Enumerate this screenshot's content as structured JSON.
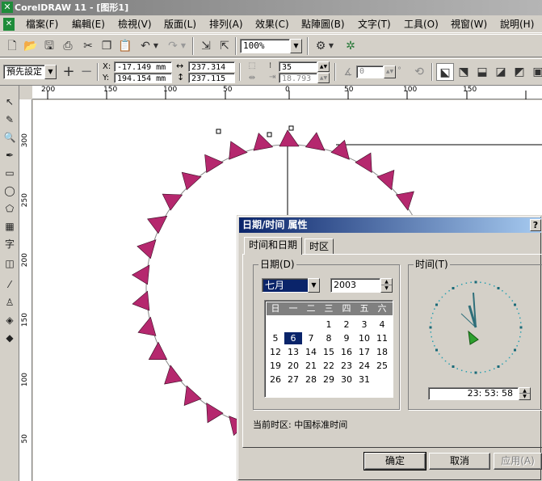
{
  "window": {
    "title": "CorelDRAW 11 - [图形1]",
    "app_icon": "coreldraw-icon"
  },
  "menu": [
    "檔案(F)",
    "編輯(E)",
    "檢視(V)",
    "版面(L)",
    "排列(A)",
    "效果(C)",
    "點陣圖(B)",
    "文字(T)",
    "工具(O)",
    "視窗(W)",
    "說明(H)"
  ],
  "standard_toolbar": {
    "zoom_value": "100%"
  },
  "property_bar": {
    "preset_label": "預先設定",
    "x_label": "X:",
    "x_value": "-17.149 mm",
    "y_label": "Y:",
    "y_value": "194.154 mm",
    "width_value": "237.314",
    "height_value": "237.115",
    "steps_value": "35",
    "offset_value": "18.793",
    "angle_value": "0",
    "degree_symbol": "°"
  },
  "ruler_h": [
    "200",
    "150",
    "100",
    "50",
    "0",
    "50",
    "100",
    "150"
  ],
  "ruler_v": [
    "300",
    "250",
    "200",
    "150",
    "100",
    "50"
  ],
  "dialog": {
    "title": "日期/时间 属性",
    "help_button": "?",
    "tabs": [
      "时间和日期",
      "时区"
    ],
    "date_group_label": "日期(D)",
    "month_value": "七月",
    "year_value": "2003",
    "weekday_headers": [
      "日",
      "一",
      "二",
      "三",
      "四",
      "五",
      "六"
    ],
    "calendar_rows": [
      [
        "",
        "",
        "",
        "1",
        "2",
        "3",
        "4"
      ],
      [
        "5",
        "6",
        "7",
        "8",
        "9",
        "10",
        "11"
      ],
      [
        "12",
        "13",
        "14",
        "15",
        "16",
        "17",
        "18"
      ],
      [
        "19",
        "20",
        "21",
        "22",
        "23",
        "24",
        "25"
      ],
      [
        "26",
        "27",
        "28",
        "29",
        "30",
        "31",
        ""
      ]
    ],
    "calendar_grid": [
      [
        "",
        "",
        "1",
        "2",
        "3",
        "4",
        ""
      ],
      [
        "6",
        "7",
        "8",
        "9",
        "10",
        "11",
        "12"
      ],
      [
        "13",
        "14",
        "15",
        "16",
        "17",
        "18",
        "19"
      ],
      [
        "20",
        "21",
        "22",
        "23",
        "24",
        "25",
        "26"
      ],
      [
        "27",
        "28",
        "29",
        "30",
        "31",
        "",
        ""
      ]
    ],
    "selected_day": "6",
    "time_group_label": "时间(T)",
    "time_value": "23: 53: 58",
    "timezone_text": "当前时区: 中国标准时间",
    "ok_button": "确定",
    "cancel_button": "取消",
    "apply_button": "应用(A)"
  },
  "colors": {
    "triangle": "#b5286e",
    "dialog_title": "#0a246a",
    "selected_day": "#0a246a",
    "clock_hand": "#3f7d86",
    "clock_cursor": "#2ea02e"
  }
}
